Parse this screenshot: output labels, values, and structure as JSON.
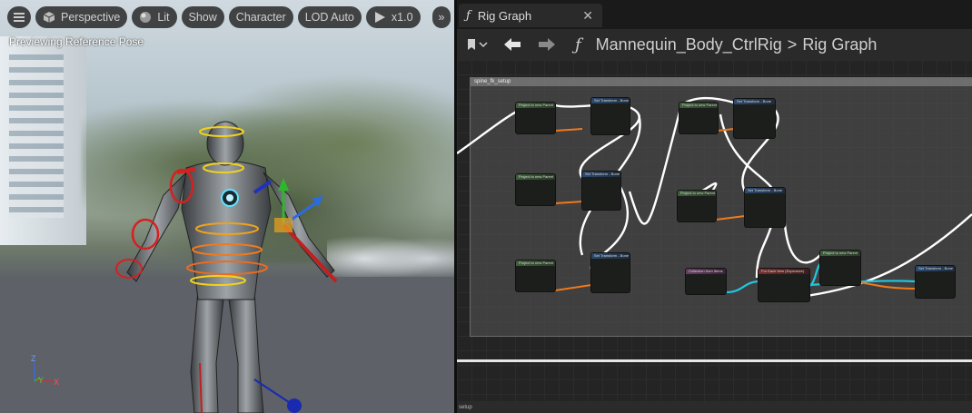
{
  "viewport": {
    "toolbar": {
      "menu_icon": "hamburger-icon",
      "perspective": "Perspective",
      "lit": "Lit",
      "show": "Show",
      "character": "Character",
      "lod": "LOD Auto",
      "play_speed": "x1.0",
      "more": "»"
    },
    "status": "Previewing Reference Pose",
    "axis": {
      "z": "Z",
      "y": "Y",
      "x": "X"
    }
  },
  "graph": {
    "tab": {
      "title": "Rig Graph",
      "icon": "function-icon",
      "close": "✕"
    },
    "nav": {
      "bookmark_icon": "bookmark-icon",
      "back_icon": "arrow-left-icon",
      "forward_icon": "arrow-right-icon",
      "crumb_root": "Mannequin_Body_CtrlRig",
      "crumb_sep": ">",
      "crumb_leaf": "Rig Graph"
    },
    "comment_title": "spine_fk_setup",
    "bottom_label": "setup",
    "nodes": [
      {
        "kind": "get",
        "label": "Project to new Parent"
      },
      {
        "kind": "set",
        "label": "Set Transform - Bone"
      },
      {
        "kind": "get",
        "label": "Project to new Parent"
      },
      {
        "kind": "set",
        "label": "Set Transform - Bone"
      },
      {
        "kind": "get",
        "label": "Project to new Parent"
      },
      {
        "kind": "set",
        "label": "Set Transform - Bone"
      },
      {
        "kind": "get",
        "label": "Project to new Parent"
      },
      {
        "kind": "set",
        "label": "Set Transform - Bone"
      },
      {
        "kind": "get",
        "label": "Project to new Parent"
      },
      {
        "kind": "set",
        "label": "Set Transform - Bone"
      },
      {
        "kind": "sel",
        "label": "Collection from Items"
      },
      {
        "kind": "dst",
        "label": "For Each Item (Expensive)"
      },
      {
        "kind": "mid",
        "label": "Project to new Parent"
      },
      {
        "kind": "set",
        "label": "Set Transform - Bone"
      }
    ]
  },
  "colors": {
    "accent_wire": "#ffffff",
    "vector_wire": "#20c8e0",
    "transform_wire": "#f07a1c"
  }
}
